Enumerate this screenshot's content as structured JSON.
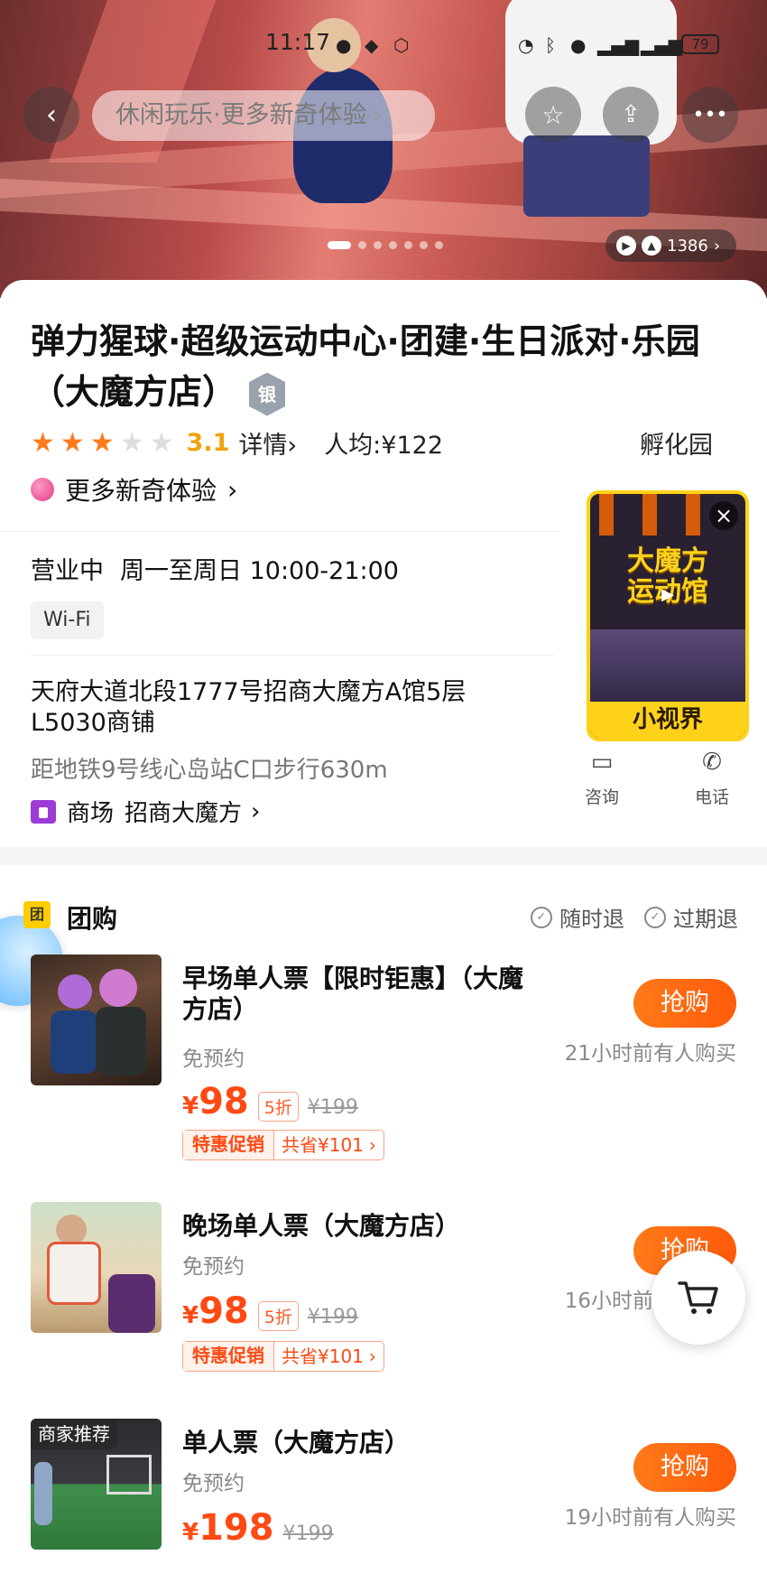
{
  "status": {
    "time": "11:17",
    "battery": "79"
  },
  "topbar": {
    "search_placeholder": "休闲玩乐·更多新奇体验",
    "search_chevron": "›"
  },
  "hero": {
    "media_count": "1386",
    "page_dots": 7,
    "active_dot": 0
  },
  "shop": {
    "title": "弹力猩球·超级运动中心·团建·生日派对·乐园（大魔方店）",
    "badge": "银",
    "stars_on": 3,
    "stars_total": 5,
    "rating": "3.1",
    "detail_label": "详情",
    "detail_chev": "›",
    "avg_price": "人均:¥122",
    "district": "孵化园",
    "more_label": "更多新奇体验",
    "more_chev": "›",
    "status": "营业中",
    "hours": "周一至周日 10:00-21:00",
    "facility": "Wi-Fi",
    "address": "天府大道北段1777号招商大魔方A馆5层L5030商铺",
    "subway": "距地铁9号线心岛站C口步行630m",
    "mall_label": "商场",
    "mall_name": "招商大魔方",
    "mall_chev": "›",
    "consult_label": "咨询",
    "phone_label": "电话"
  },
  "mini_video": {
    "title_line1": "大魔方",
    "title_line2": "运动馆",
    "caption": "小视界"
  },
  "groupbuy": {
    "title": "团购",
    "icon_text": "团",
    "tag1": "随时退",
    "tag2": "过期退",
    "deals": [
      {
        "name": "早场单人票【限时钜惠】（大魔方店）",
        "booking": "免预约",
        "currency": "¥",
        "price": "98",
        "discount": "5折",
        "orig": "¥199",
        "promo_label": "特惠促销",
        "promo_value": "共省¥101",
        "promo_chev": "›",
        "buy_label": "抢购",
        "recent": "21小时前有人购买"
      },
      {
        "name": "晚场单人票（大魔方店）",
        "booking": "免预约",
        "currency": "¥",
        "price": "98",
        "discount": "5折",
        "orig": "¥199",
        "promo_label": "特惠促销",
        "promo_value": "共省¥101",
        "promo_chev": "›",
        "buy_label": "抢购",
        "recent": "16小时前有人购买"
      },
      {
        "name": "单人票（大魔方店）",
        "booking": "免预约",
        "currency": "¥",
        "price": "198",
        "orig": "¥199",
        "merchant_tag": "商家推荐",
        "buy_label": "抢购",
        "recent": "19小时前有人购买"
      }
    ]
  },
  "colors": {
    "accent": "#ff5a0a",
    "price": "#ff4a14",
    "rating": "#f2a20d",
    "star": "#ff7a1a"
  }
}
